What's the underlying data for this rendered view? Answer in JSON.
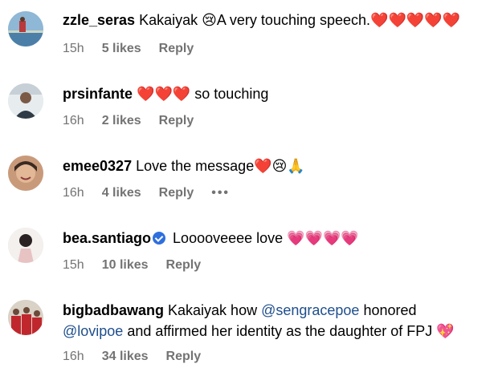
{
  "comments": [
    {
      "username": "zzle_seras",
      "text_prefix": "Kakaiyak ",
      "emoji_face": "😢",
      "text_main": "A very touching speech.",
      "hearts": "❤️❤️❤️❤️❤️",
      "time": "15h",
      "likes": "5 likes",
      "reply": "Reply"
    },
    {
      "username": "prsinfante",
      "hearts": "❤️❤️❤️",
      "text_main": " so touching",
      "time": "16h",
      "likes": "2 likes",
      "reply": "Reply"
    },
    {
      "username": "emee0327",
      "text_main": "Love the message",
      "emojis": "❤️😢🙏",
      "time": "16h",
      "likes": "4 likes",
      "reply": "Reply",
      "more": "•••"
    },
    {
      "username": "bea.santiago",
      "text_main": "Looooveeee love ",
      "hearts": "💗💗💗💗",
      "time": "15h",
      "likes": "10 likes",
      "reply": "Reply"
    },
    {
      "username": "bigbadbawang",
      "text_line1_a": "Kakaiyak how ",
      "mention1": "@sengracepoe",
      "text_line1_b": " honored",
      "mention2": "@lovipoe",
      "text_line2": " and affirmed her identity as the daughter of FPJ ",
      "emoji_end": "💖",
      "time": "16h",
      "likes": "34 likes",
      "reply": "Reply"
    }
  ]
}
